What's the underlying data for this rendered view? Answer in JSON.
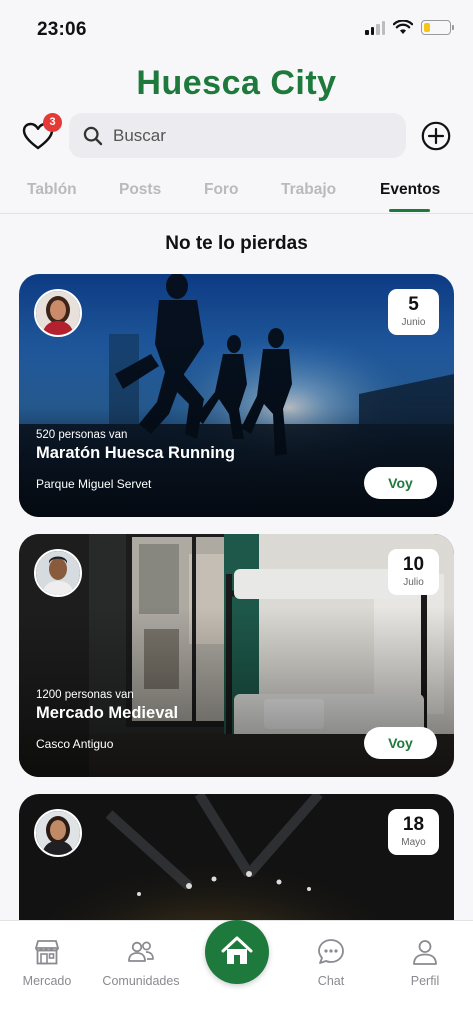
{
  "status_bar": {
    "time": "23:06",
    "battery_level": 0.25
  },
  "app": {
    "title": "Huesca City"
  },
  "header": {
    "favorites_count": "3",
    "search_placeholder": "Buscar"
  },
  "tabs": [
    {
      "label": "Tablón"
    },
    {
      "label": "Posts"
    },
    {
      "label": "Foro"
    },
    {
      "label": "Trabajo"
    },
    {
      "label": "Eventos",
      "active": true
    }
  ],
  "section_title": "No te lo pierdas",
  "events": [
    {
      "attendees": "520 personas van",
      "name": "Maratón Huesca Running",
      "place": "Parque Miguel Servet",
      "day": "5",
      "month": "Junio",
      "action": "Voy"
    },
    {
      "attendees": "1200 personas van",
      "name": "Mercado Medieval",
      "place": "Casco Antiguo",
      "day": "10",
      "month": "Julio",
      "action": "Voy"
    },
    {
      "day": "18",
      "month": "Mayo"
    }
  ],
  "bottom_nav": [
    {
      "label": "Mercado",
      "icon": "store-icon"
    },
    {
      "label": "Comunidades",
      "icon": "people-icon"
    },
    {
      "label": "",
      "icon": "home-icon"
    },
    {
      "label": "Chat",
      "icon": "chat-icon"
    },
    {
      "label": "Perfil",
      "icon": "person-icon"
    }
  ],
  "colors": {
    "brand": "#1e7a3c",
    "badge": "#e53935"
  }
}
